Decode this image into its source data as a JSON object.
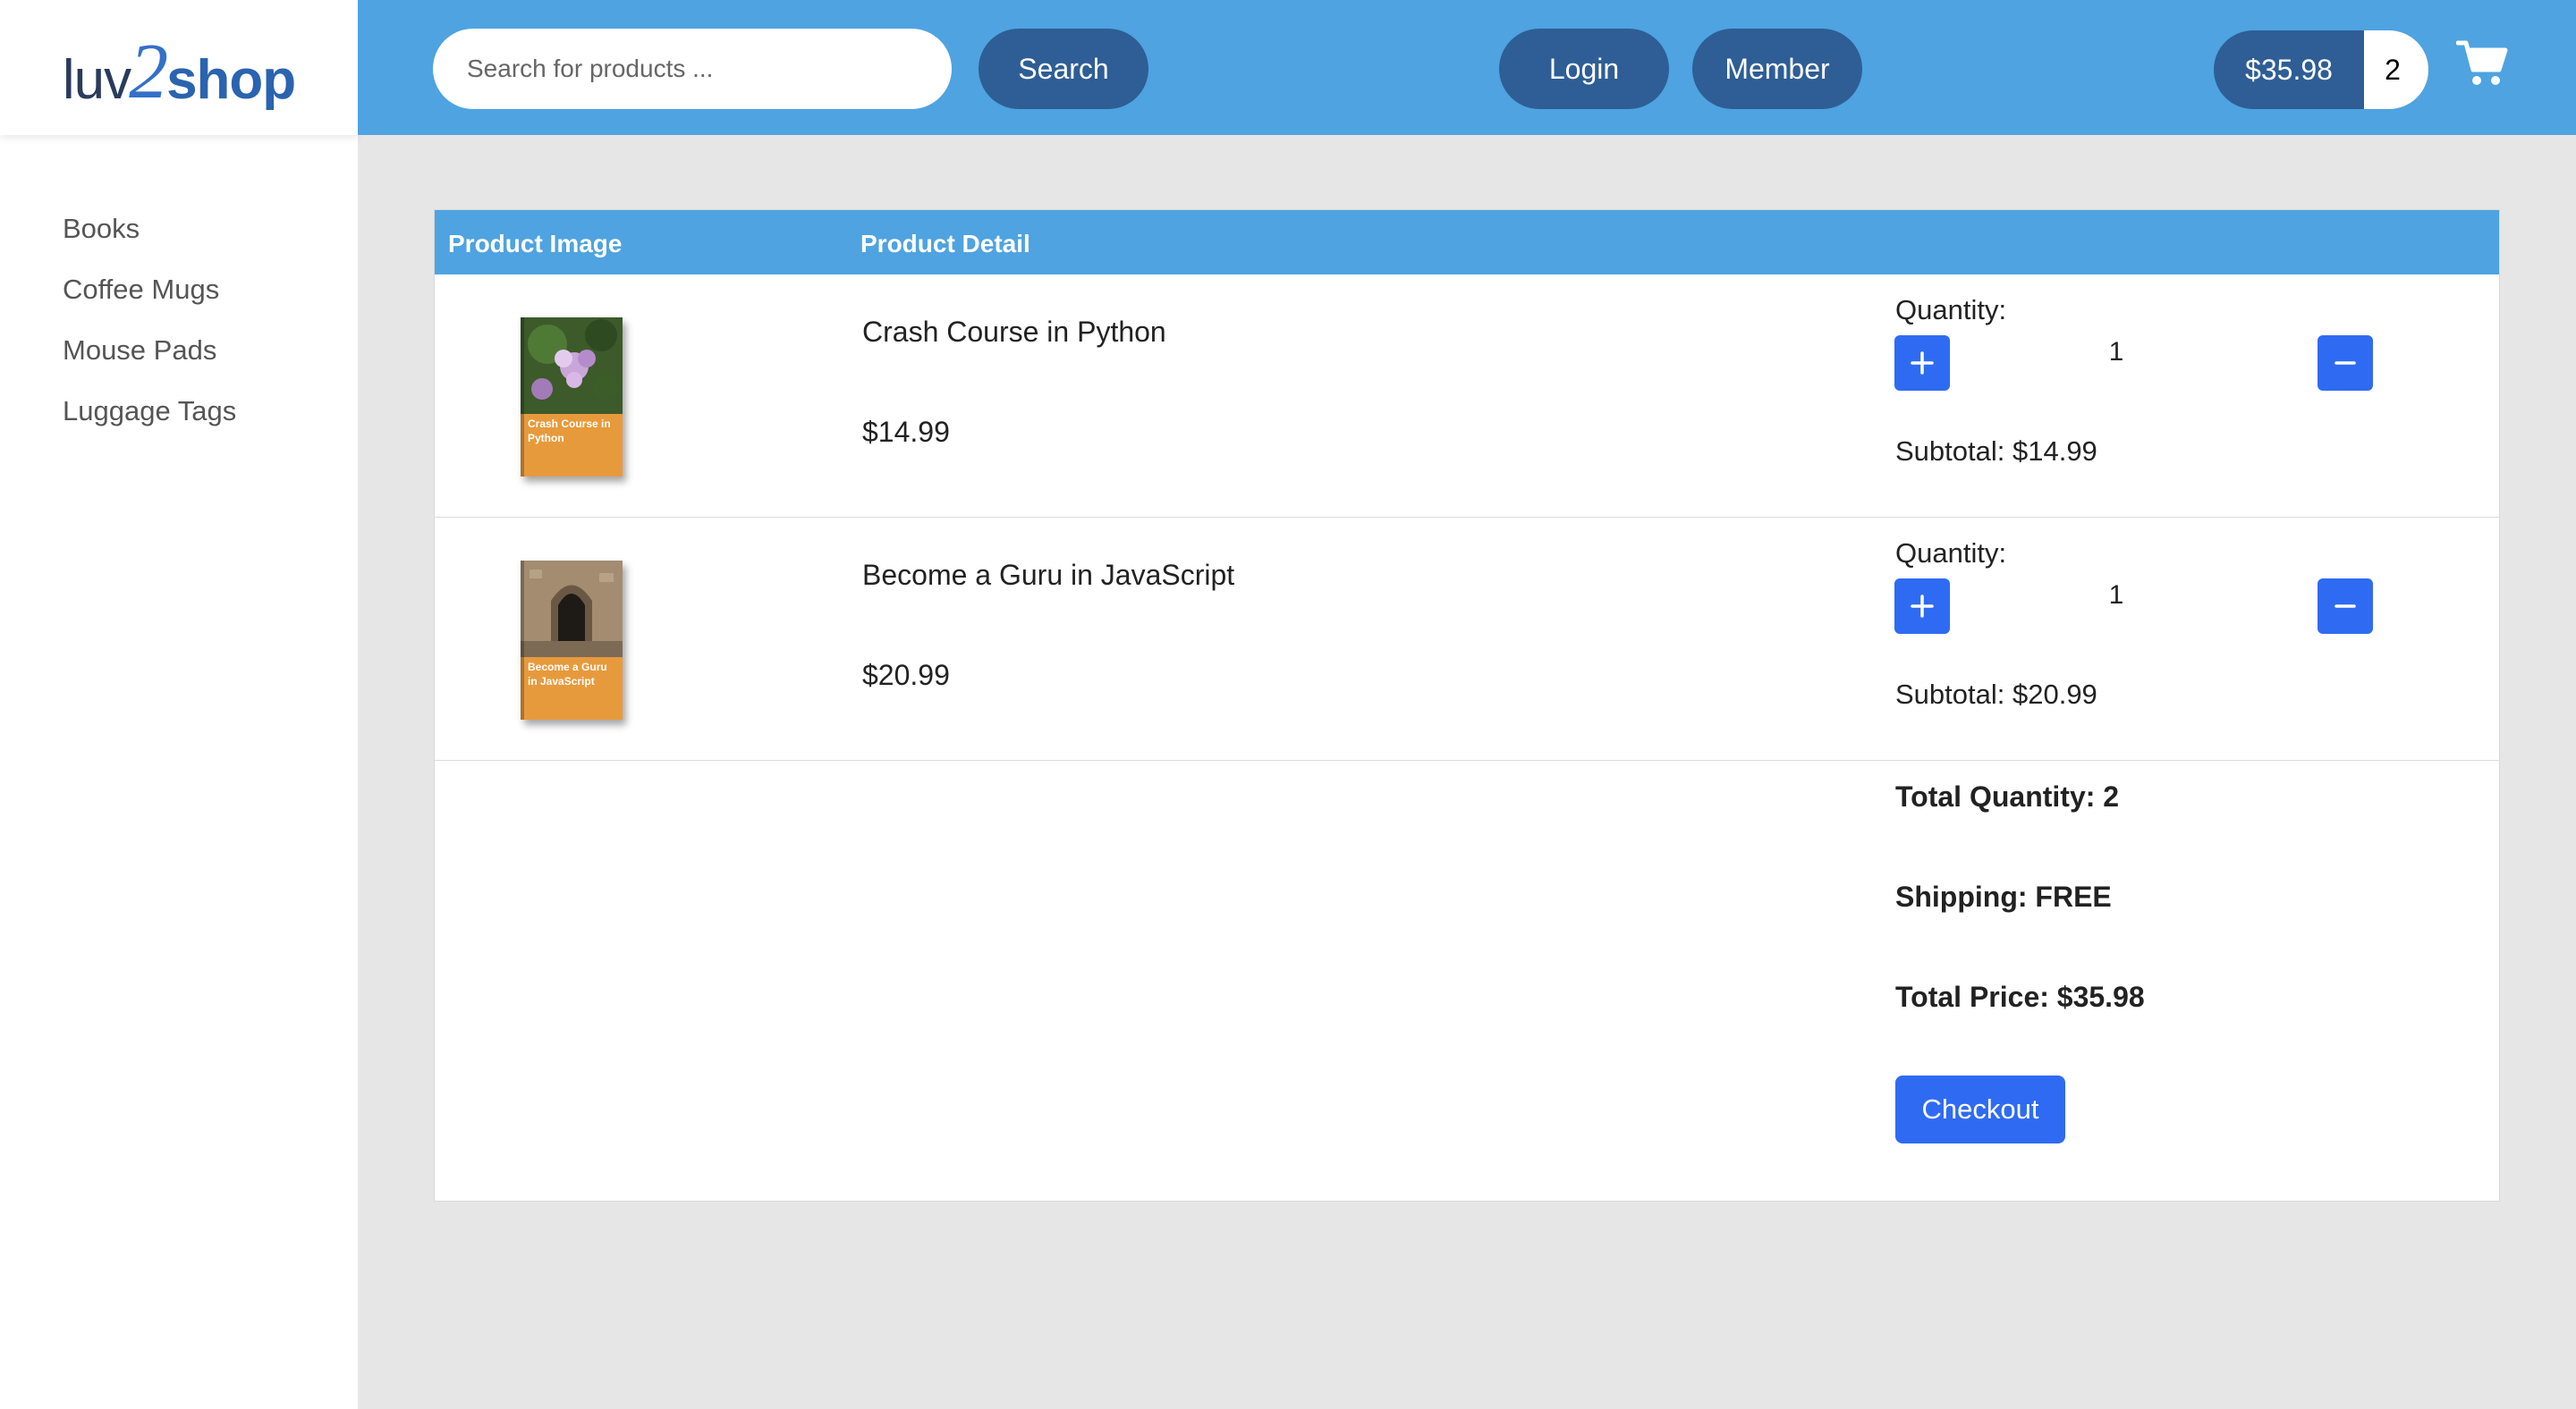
{
  "brand": {
    "part1": "luv",
    "part2": "2",
    "part3": "shop"
  },
  "sidebar": {
    "items": [
      {
        "label": "Books"
      },
      {
        "label": "Coffee Mugs"
      },
      {
        "label": "Mouse Pads"
      },
      {
        "label": "Luggage Tags"
      }
    ]
  },
  "header": {
    "search_placeholder": "Search for products ...",
    "search_label": "Search",
    "login_label": "Login",
    "member_label": "Member",
    "cart_total": "$35.98",
    "cart_count": "2",
    "cart_icon": "shopping-cart-icon"
  },
  "table": {
    "col_image": "Product Image",
    "col_detail": "Product Detail",
    "rows": [
      {
        "name": "Crash Course in Python",
        "price": "$14.99",
        "cover_title": "Crash Course in Python",
        "quantity_label": "Quantity:",
        "quantity": "1",
        "subtotal": "Subtotal: $14.99"
      },
      {
        "name": "Become a Guru in JavaScript",
        "price": "$20.99",
        "cover_title": "Become a Guru in JavaScript",
        "quantity_label": "Quantity:",
        "quantity": "1",
        "subtotal": "Subtotal: $20.99"
      }
    ]
  },
  "summary": {
    "total_quantity": "Total Quantity: 2",
    "shipping": "Shipping: FREE",
    "total_price": "Total Price: $35.98",
    "checkout_label": "Checkout"
  },
  "colors": {
    "header_bg": "#4ea3e0",
    "pill_bg": "#2e5e95",
    "action_blue": "#2f6bf2",
    "page_bg": "#e6e6e6"
  }
}
